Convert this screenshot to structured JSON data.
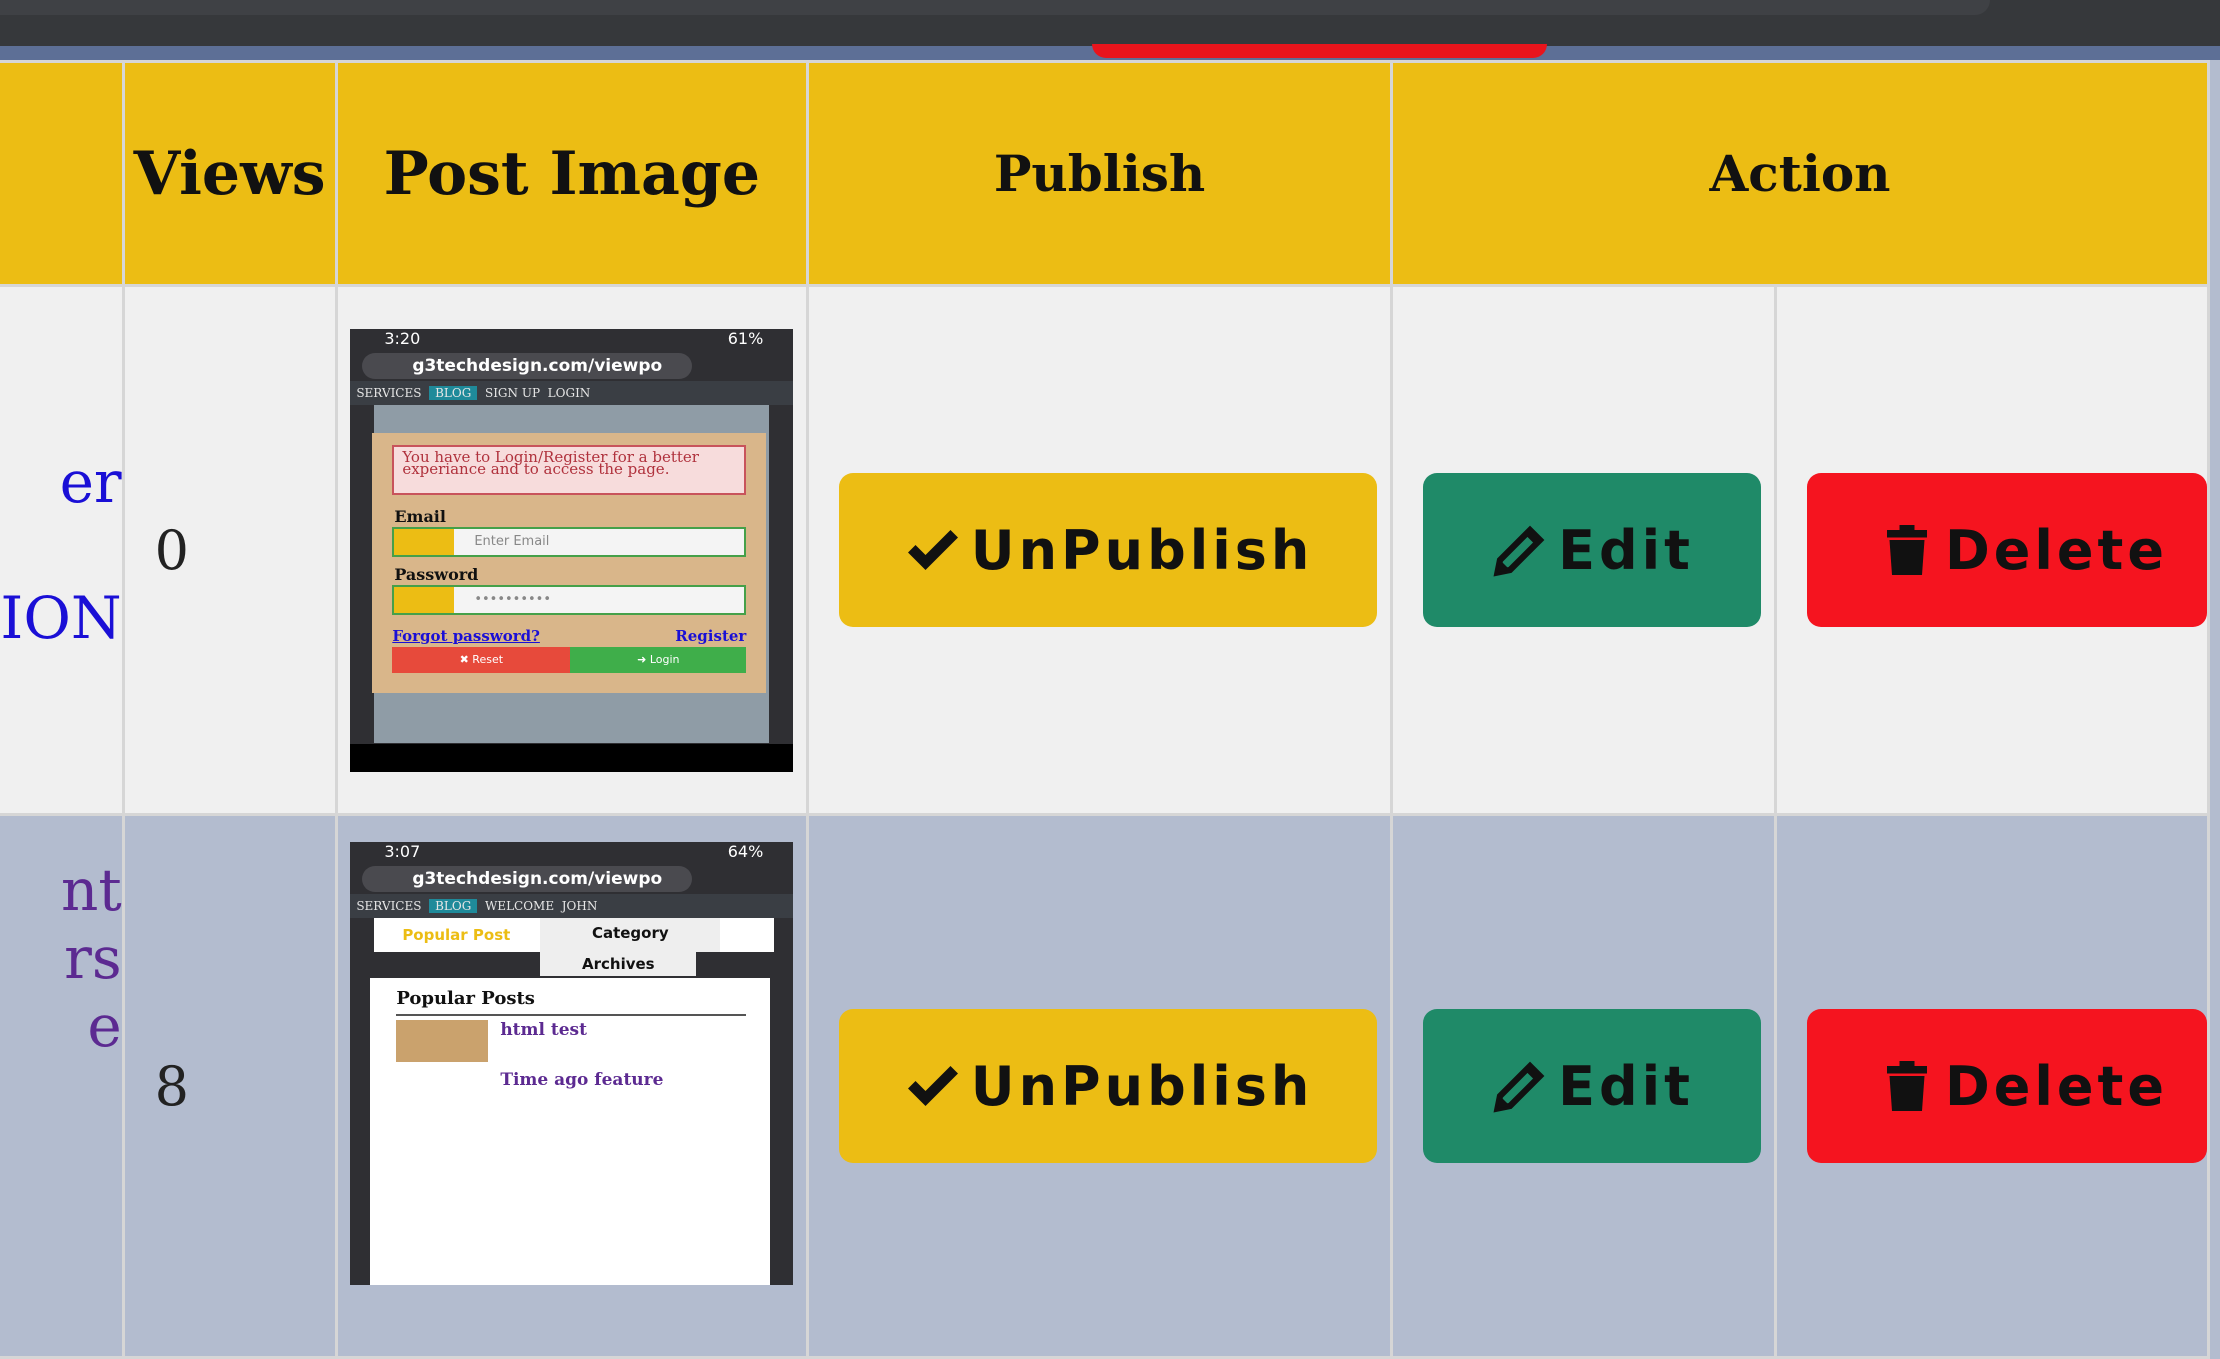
{
  "header": {
    "views": "Views",
    "post_image": "Post Image",
    "publish": "Publish",
    "action": "Action"
  },
  "rows": [
    {
      "title_lines": [
        "er",
        "",
        "ION"
      ],
      "views": "0",
      "screenshot": {
        "time": "3:20",
        "battery": "61%",
        "url": "g3techdesign.com/viewpo",
        "nav": [
          "SERVICES",
          "BLOG",
          "SIGN UP",
          "LOGIN"
        ],
        "alert": "You have to Login/Register for a better experiance and to access the page.",
        "email_label": "Email",
        "email_placeholder": "Enter Email",
        "password_label": "Password",
        "password_value": "••••••••••",
        "forgot": "Forgot password?",
        "register": "Register",
        "reset": "✖ Reset",
        "login": "➜ Login"
      },
      "publish_label": "UnPublish",
      "edit_label": "Edit",
      "delete_label": "Delete"
    },
    {
      "title_lines": [
        "nt",
        "rs",
        "e"
      ],
      "views": "8",
      "screenshot": {
        "time": "3:07",
        "battery": "64%",
        "url": "g3techdesign.com/viewpo",
        "nav": [
          "SERVICES",
          "BLOG",
          "WELCOME",
          "JOHN"
        ],
        "tab_popular": "Popular Post",
        "tab_category": "Category",
        "tab_archives": "Archives",
        "popular_title": "Popular Posts",
        "item1": "html test",
        "item2": "Time ago feature"
      },
      "publish_label": "UnPublish",
      "edit_label": "Edit",
      "delete_label": "Delete"
    }
  ],
  "colors": {
    "header_bg": "#ecbd14",
    "publish_btn": "#ecbd14",
    "edit_btn": "#1f8a68",
    "delete_btn": "#f5141f",
    "row_alt_bg": "#b3bccf"
  },
  "icons": {
    "publish": "check-icon",
    "edit": "pencil-icon",
    "delete": "trash-icon"
  }
}
